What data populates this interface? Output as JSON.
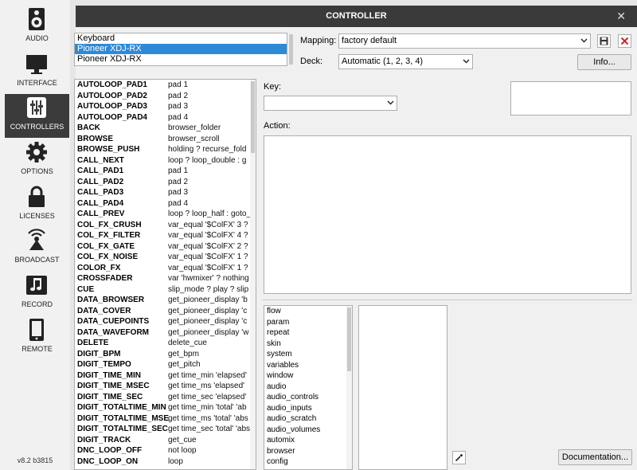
{
  "window": {
    "title": "CONTROLLER",
    "close_glyph": "✕"
  },
  "sidebar": {
    "items": [
      {
        "label": "AUDIO",
        "icon": "speaker-icon",
        "active": false
      },
      {
        "label": "INTERFACE",
        "icon": "monitor-icon",
        "active": false
      },
      {
        "label": "CONTROLLERS",
        "icon": "sliders-icon",
        "active": true
      },
      {
        "label": "OPTIONS",
        "icon": "gear-icon",
        "active": false
      },
      {
        "label": "LICENSES",
        "icon": "lock-icon",
        "active": false
      },
      {
        "label": "BROADCAST",
        "icon": "broadcast-icon",
        "active": false
      },
      {
        "label": "RECORD",
        "icon": "music-icon",
        "active": false
      },
      {
        "label": "REMOTE",
        "icon": "tablet-icon",
        "active": false
      }
    ],
    "version": "v8.2 b3815"
  },
  "devices": {
    "items": [
      "Keyboard",
      "Pioneer XDJ-RX",
      "Pioneer XDJ-RX"
    ],
    "selected_index": 1
  },
  "mapping": {
    "label": "Mapping:",
    "value": "factory default"
  },
  "deck": {
    "label": "Deck:",
    "value": "Automatic (1, 2, 3, 4)"
  },
  "info_button": "Info...",
  "actions": [
    {
      "key": "AUTOLOOP_PAD1",
      "value": "pad 1"
    },
    {
      "key": "AUTOLOOP_PAD2",
      "value": "pad 2"
    },
    {
      "key": "AUTOLOOP_PAD3",
      "value": "pad 3"
    },
    {
      "key": "AUTOLOOP_PAD4",
      "value": "pad 4"
    },
    {
      "key": "BACK",
      "value": "browser_folder"
    },
    {
      "key": "BROWSE",
      "value": "browser_scroll"
    },
    {
      "key": "BROWSE_PUSH",
      "value": "holding ? recurse_fold"
    },
    {
      "key": "CALL_NEXT",
      "value": "loop ? loop_double : g"
    },
    {
      "key": "CALL_PAD1",
      "value": "pad 1"
    },
    {
      "key": "CALL_PAD2",
      "value": "pad 2"
    },
    {
      "key": "CALL_PAD3",
      "value": "pad 3"
    },
    {
      "key": "CALL_PAD4",
      "value": "pad 4"
    },
    {
      "key": "CALL_PREV",
      "value": "loop ? loop_half : goto_"
    },
    {
      "key": "COL_FX_CRUSH",
      "value": "var_equal '$ColFX' 3 ?"
    },
    {
      "key": "COL_FX_FILTER",
      "value": "var_equal '$ColFX' 4 ?"
    },
    {
      "key": "COL_FX_GATE",
      "value": "var_equal '$ColFX' 2 ?"
    },
    {
      "key": "COL_FX_NOISE",
      "value": "var_equal '$ColFX' 1 ?"
    },
    {
      "key": "COLOR_FX",
      "value": "var_equal '$ColFX' 1 ?"
    },
    {
      "key": "CROSSFADER",
      "value": "var 'hwmixer' ? nothing"
    },
    {
      "key": "CUE",
      "value": "slip_mode ? play ? slip"
    },
    {
      "key": "DATA_BROWSER",
      "value": "get_pioneer_display 'b"
    },
    {
      "key": "DATA_COVER",
      "value": "get_pioneer_display 'c"
    },
    {
      "key": "DATA_CUEPOINTS",
      "value": "get_pioneer_display 'c"
    },
    {
      "key": "DATA_WAVEFORM",
      "value": "get_pioneer_display 'w"
    },
    {
      "key": "DELETE",
      "value": "delete_cue"
    },
    {
      "key": "DIGIT_BPM",
      "value": "get_bpm"
    },
    {
      "key": "DIGIT_TEMPO",
      "value": "get_pitch"
    },
    {
      "key": "DIGIT_TIME_MIN",
      "value": "get time_min 'elapsed'"
    },
    {
      "key": "DIGIT_TIME_MSEC",
      "value": "get time_ms 'elapsed'"
    },
    {
      "key": "DIGIT_TIME_SEC",
      "value": "get time_sec 'elapsed'"
    },
    {
      "key": "DIGIT_TOTALTIME_MIN",
      "value": "get time_min 'total' 'ab"
    },
    {
      "key": "DIGIT_TOTALTIME_MSE",
      "value": "get time_ms 'total' 'abs"
    },
    {
      "key": "DIGIT_TOTALTIME_SEC",
      "value": "get time_sec 'total' 'abs"
    },
    {
      "key": "DIGIT_TRACK",
      "value": "get_cue"
    },
    {
      "key": "DNC_LOOP_OFF",
      "value": "not loop"
    },
    {
      "key": "DNC_LOOP_ON",
      "value": "loop"
    }
  ],
  "key_field": {
    "label": "Key:",
    "value": ""
  },
  "action_field": {
    "label": "Action:",
    "value": ""
  },
  "categories": [
    "flow",
    "param",
    "repeat",
    "skin",
    "system",
    "variables",
    "window",
    "audio",
    "audio_controls",
    "audio_inputs",
    "audio_scratch",
    "audio_volumes",
    "automix",
    "browser",
    "config"
  ],
  "documentation_button": "Documentation...",
  "colors": {
    "selection": "#2f8ad6",
    "titlebar": "#3a3a3a",
    "active_nav": "#3b3b3b"
  }
}
